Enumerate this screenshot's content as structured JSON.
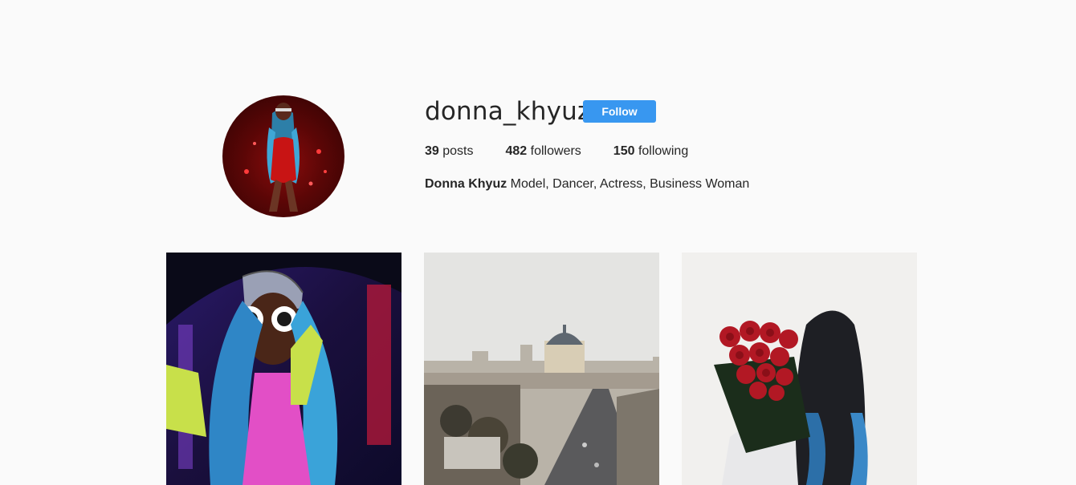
{
  "profile": {
    "username": "donna_khyuz",
    "follow_label": "Follow",
    "posts_count": "39",
    "posts_label": "posts",
    "followers_count": "482",
    "followers_label": "followers",
    "following_count": "150",
    "following_label": "following",
    "full_name": "Donna Khyuz",
    "bio": "Model, Dancer, Actress, Business Woman"
  },
  "colors": {
    "follow_button": "#3897f0",
    "background": "#fafafa",
    "text": "#262626"
  }
}
